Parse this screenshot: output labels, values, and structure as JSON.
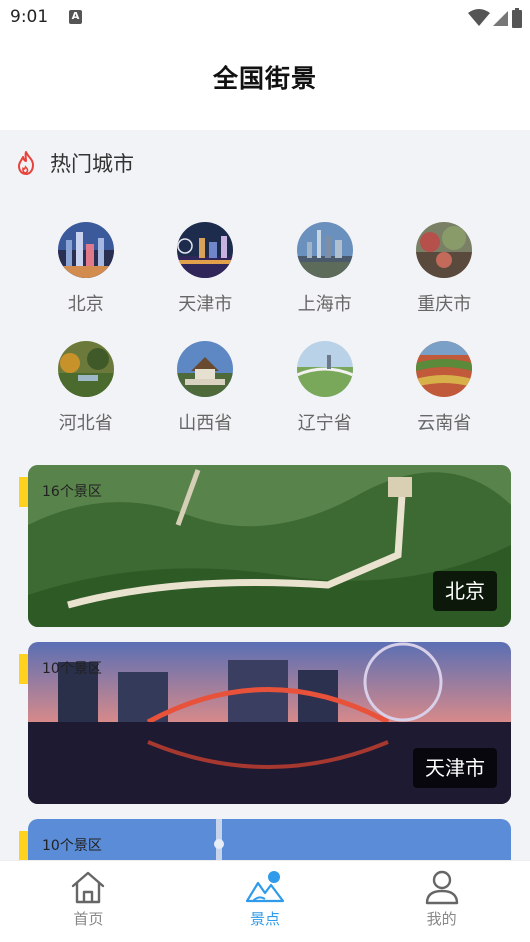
{
  "status_bar": {
    "time": "9:01",
    "notification_icon": "A"
  },
  "header": {
    "title": "全国街景"
  },
  "hot_cities": {
    "title": "热门城市",
    "icon": "flame-icon",
    "items": [
      {
        "name": "北京"
      },
      {
        "name": "天津市"
      },
      {
        "name": "上海市"
      },
      {
        "name": "重庆市"
      },
      {
        "name": "河北省"
      },
      {
        "name": "山西省"
      },
      {
        "name": "辽宁省"
      },
      {
        "name": "云南省"
      }
    ]
  },
  "cards": [
    {
      "badge": "16个景区",
      "name": "北京"
    },
    {
      "badge": "10个景区",
      "name": "天津市"
    },
    {
      "badge": "10个景区",
      "name": ""
    }
  ],
  "tabbar": {
    "items": [
      {
        "label": "首页",
        "icon": "home-icon",
        "active": false
      },
      {
        "label": "景点",
        "icon": "mountain-icon",
        "active": true
      },
      {
        "label": "我的",
        "icon": "user-icon",
        "active": false
      }
    ],
    "accent_color": "#2f9bea"
  }
}
